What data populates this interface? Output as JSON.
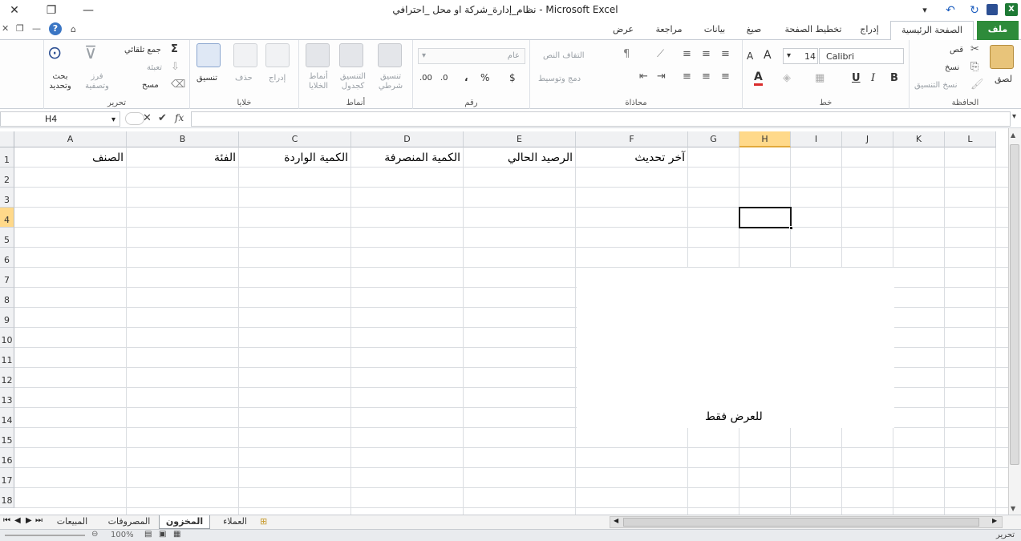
{
  "window": {
    "title": "نظام_إدارة_شركة او محل _احترافي  -  Microsoft Excel",
    "minimize_glyph": "—",
    "restore_glyph": "❐",
    "close_glyph": "✕"
  },
  "ribbon_tabs": [
    {
      "label": "ملف",
      "active": false
    },
    {
      "label": "الصفحة الرئيسية",
      "active": true
    },
    {
      "label": "إدراج",
      "active": false
    },
    {
      "label": "تخطيط الصفحة",
      "active": false
    },
    {
      "label": "صيغ",
      "active": false
    },
    {
      "label": "بيانات",
      "active": false
    },
    {
      "label": "مراجعة",
      "active": false
    },
    {
      "label": "عرض",
      "active": false
    }
  ],
  "ribbon": {
    "clipboard": {
      "label": "الحافظة",
      "paste": "لصق",
      "cut": "قص",
      "copy": "نسخ",
      "format_painter": "نسخ التنسيق"
    },
    "font": {
      "label": "خط",
      "font_name": "Calibri",
      "font_size": "14",
      "bold": "B",
      "italic": "I",
      "underline": "U"
    },
    "alignment": {
      "label": "محاذاة",
      "wrap_text": "التفاف النص",
      "merge_center": "دمج وتوسيط"
    },
    "number": {
      "label": "رقم",
      "format": "عام",
      "currency": "$",
      "percent": "%",
      "comma": "،"
    },
    "styles": {
      "label": "أنماط",
      "conditional": "تنسيق شرطي",
      "as_table": "التنسيق كجدول",
      "cell_styles": "أنماط الخلايا"
    },
    "cells": {
      "label": "خلايا",
      "insert": "إدراج",
      "delete": "حذف",
      "format": "تنسيق"
    },
    "editing": {
      "label": "تحرير",
      "autosum": "جمع تلقائي",
      "fill": "تعبئة",
      "clear": "مسح",
      "sort_filter": "فرز وتصفية",
      "find_select": "بحث وتحديد"
    }
  },
  "formula_bar": {
    "name_box": "H4",
    "fx": "fx",
    "cancel": "✕",
    "enter": "✔",
    "content": ""
  },
  "grid": {
    "columns": [
      "A",
      "B",
      "C",
      "D",
      "E",
      "F",
      "G",
      "H",
      "I",
      "J",
      "K",
      "L"
    ],
    "selected_column": "H",
    "rows": [
      "1",
      "2",
      "3",
      "4",
      "5",
      "6",
      "7",
      "8",
      "9",
      "10",
      "11",
      "12",
      "13",
      "14",
      "15",
      "16",
      "17",
      "18"
    ],
    "selected_row": "4",
    "selected_cell": "H4",
    "header_row": {
      "A": "الصنف",
      "B": "الفئة",
      "C": "الكمية الواردة",
      "D": "الكمية المنصرفة",
      "E": "الرصيد الحالي",
      "F": "آخر تحديث"
    },
    "overlay_text": "للعرض فقط"
  },
  "sheet_tabs": [
    {
      "label": "المبيعات",
      "active": false
    },
    {
      "label": "المصروفات",
      "active": false
    },
    {
      "label": "المخزون",
      "active": true
    },
    {
      "label": "العملاء",
      "active": false
    }
  ],
  "status_bar": {
    "mode": "تحرير",
    "zoom": "100%"
  }
}
